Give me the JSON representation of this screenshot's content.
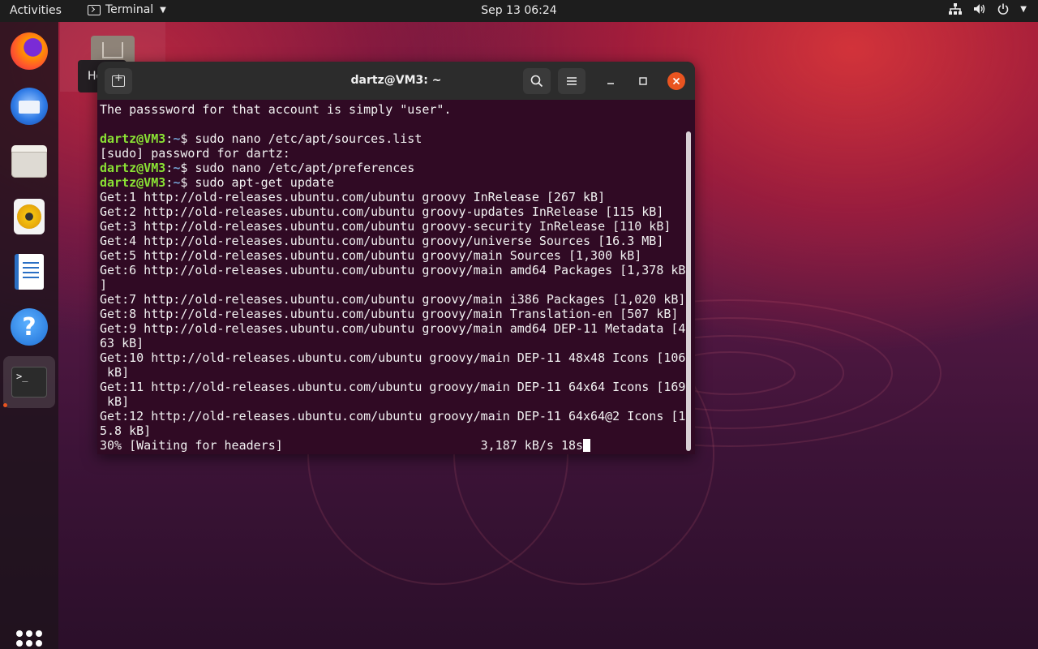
{
  "topbar": {
    "activities": "Activities",
    "app_name": "Terminal",
    "clock": "Sep 13  06:24",
    "tray_icons": [
      "network-icon",
      "volume-icon",
      "power-icon"
    ]
  },
  "dock": {
    "items": [
      "firefox",
      "thunderbird",
      "files",
      "rhythmbox",
      "libreoffice-writer",
      "help",
      "terminal"
    ],
    "terminal_glyph": ">_"
  },
  "desktop": {
    "home_label": "Ho"
  },
  "terminal": {
    "title": "dartz@VM3: ~",
    "lines": [
      {
        "text": "The passsword for that account is simply \"user\"."
      },
      {
        "text": ""
      },
      {
        "user": "dartz@VM3",
        "path": "~",
        "cmd": "$ sudo nano /etc/apt/sources.list"
      },
      {
        "text": "[sudo] password for dartz:"
      },
      {
        "user": "dartz@VM3",
        "path": "~",
        "cmd": "$ sudo nano /etc/apt/preferences"
      },
      {
        "user": "dartz@VM3",
        "path": "~",
        "cmd": "$ sudo apt-get update"
      },
      {
        "text": "Get:1 http://old-releases.ubuntu.com/ubuntu groovy InRelease [267 kB]"
      },
      {
        "text": "Get:2 http://old-releases.ubuntu.com/ubuntu groovy-updates InRelease [115 kB]"
      },
      {
        "text": "Get:3 http://old-releases.ubuntu.com/ubuntu groovy-security InRelease [110 kB]"
      },
      {
        "text": "Get:4 http://old-releases.ubuntu.com/ubuntu groovy/universe Sources [16.3 MB]"
      },
      {
        "text": "Get:5 http://old-releases.ubuntu.com/ubuntu groovy/main Sources [1,300 kB]"
      },
      {
        "text": "Get:6 http://old-releases.ubuntu.com/ubuntu groovy/main amd64 Packages [1,378 kB"
      },
      {
        "text": "]"
      },
      {
        "text": "Get:7 http://old-releases.ubuntu.com/ubuntu groovy/main i386 Packages [1,020 kB]"
      },
      {
        "text": "Get:8 http://old-releases.ubuntu.com/ubuntu groovy/main Translation-en [507 kB]"
      },
      {
        "text": "Get:9 http://old-releases.ubuntu.com/ubuntu groovy/main amd64 DEP-11 Metadata [4"
      },
      {
        "text": "63 kB]"
      },
      {
        "text": "Get:10 http://old-releases.ubuntu.com/ubuntu groovy/main DEP-11 48x48 Icons [106"
      },
      {
        "text": " kB]"
      },
      {
        "text": "Get:11 http://old-releases.ubuntu.com/ubuntu groovy/main DEP-11 64x64 Icons [169"
      },
      {
        "text": " kB]"
      },
      {
        "text": "Get:12 http://old-releases.ubuntu.com/ubuntu groovy/main DEP-11 64x64@2 Icons [1"
      },
      {
        "text": "5.8 kB]"
      },
      {
        "text": "30% [Waiting for headers]                           3,187 kB/s 18s",
        "cursor": true
      }
    ]
  }
}
